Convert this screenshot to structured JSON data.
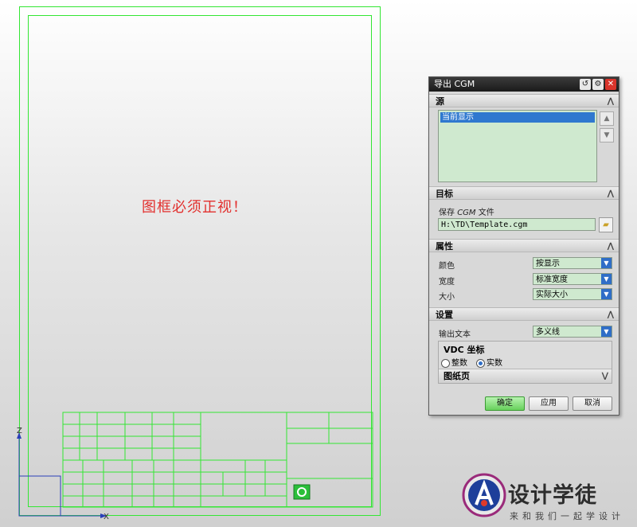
{
  "canvas": {
    "frame_warning": "图框必须正视！",
    "axis_z": "Z",
    "axis_x": "X"
  },
  "dialog": {
    "title": "导出 CGM",
    "source": {
      "heading": "源",
      "items": [
        "当前显示"
      ]
    },
    "target": {
      "heading": "目标",
      "save_label_prefix": "保存",
      "save_label_cgm": "CGM",
      "save_label_suffix": "文件",
      "path_value": "H:\\TD\\Template.cgm"
    },
    "properties": {
      "heading": "属性",
      "color_label": "颜色",
      "color_value": "按显示",
      "width_label": "宽度",
      "width_value": "标准宽度",
      "size_label": "大小",
      "size_value": "实际大小"
    },
    "settings": {
      "heading": "设置",
      "output_text_label": "输出文本",
      "output_text_value": "多义线",
      "vdc_title": "VDC 坐标",
      "vdc_integer": "整数",
      "vdc_real": "实数",
      "vdc_selected": "实数",
      "sheet_label": "图纸页"
    },
    "buttons": {
      "ok": "确定",
      "apply": "应用",
      "cancel": "取消"
    }
  },
  "watermark": {
    "title": "设计学徒",
    "subtitle": "来和我们一起学设计"
  },
  "colors": {
    "frame_line": "#33e633",
    "warning_text": "#e2302e",
    "field_bg": "#cfe9cf",
    "selection": "#2f78cf",
    "ok_button": "#68d15c",
    "close_button": "#d9342b"
  },
  "icons": [
    "reset-icon",
    "gear-icon",
    "close-icon",
    "collapse-icon",
    "move-up-icon",
    "move-down-icon",
    "folder-icon",
    "dropdown-icon",
    "expand-icon",
    "logo-icon"
  ]
}
